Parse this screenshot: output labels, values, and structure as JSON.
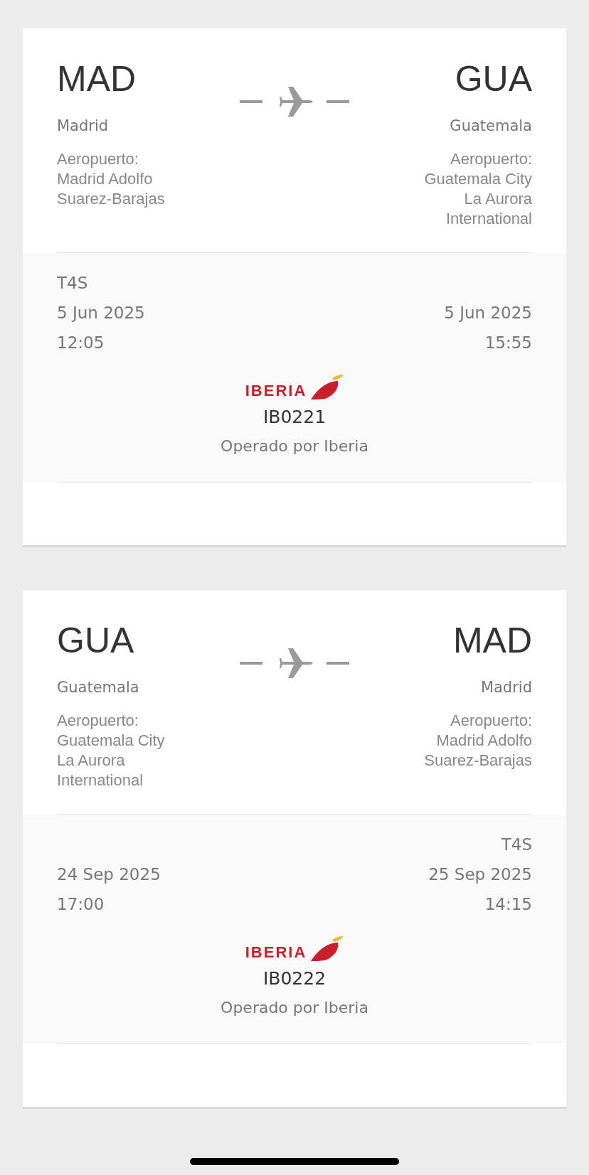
{
  "flights": [
    {
      "origin": {
        "code": "MAD",
        "city": "Madrid",
        "airport": "Aeropuerto:\nMadrid Adolfo\nSuarez-Barajas",
        "terminal": "T4S",
        "date": "5 Jun 2025",
        "time": "12:05"
      },
      "destination": {
        "code": "GUA",
        "city": "Guatemala",
        "airport": "Aeropuerto:\nGuatemala City\nLa Aurora\nInternational",
        "date": "5 Jun 2025",
        "time": "15:55"
      },
      "airline_logo": "IBERIA",
      "flight_number": "IB0221",
      "operator": "Operado por Iberia"
    },
    {
      "origin": {
        "code": "GUA",
        "city": "Guatemala",
        "airport": "Aeropuerto:\nGuatemala City\nLa Aurora\nInternational",
        "date": "24 Sep 2025",
        "time": "17:00"
      },
      "destination": {
        "code": "MAD",
        "city": "Madrid",
        "airport": "Aeropuerto:\nMadrid Adolfo\nSuarez-Barajas",
        "terminal": "T4S",
        "date": "25 Sep 2025",
        "time": "14:15"
      },
      "airline_logo": "IBERIA",
      "flight_number": "IB0222",
      "operator": "Operado por Iberia"
    }
  ]
}
